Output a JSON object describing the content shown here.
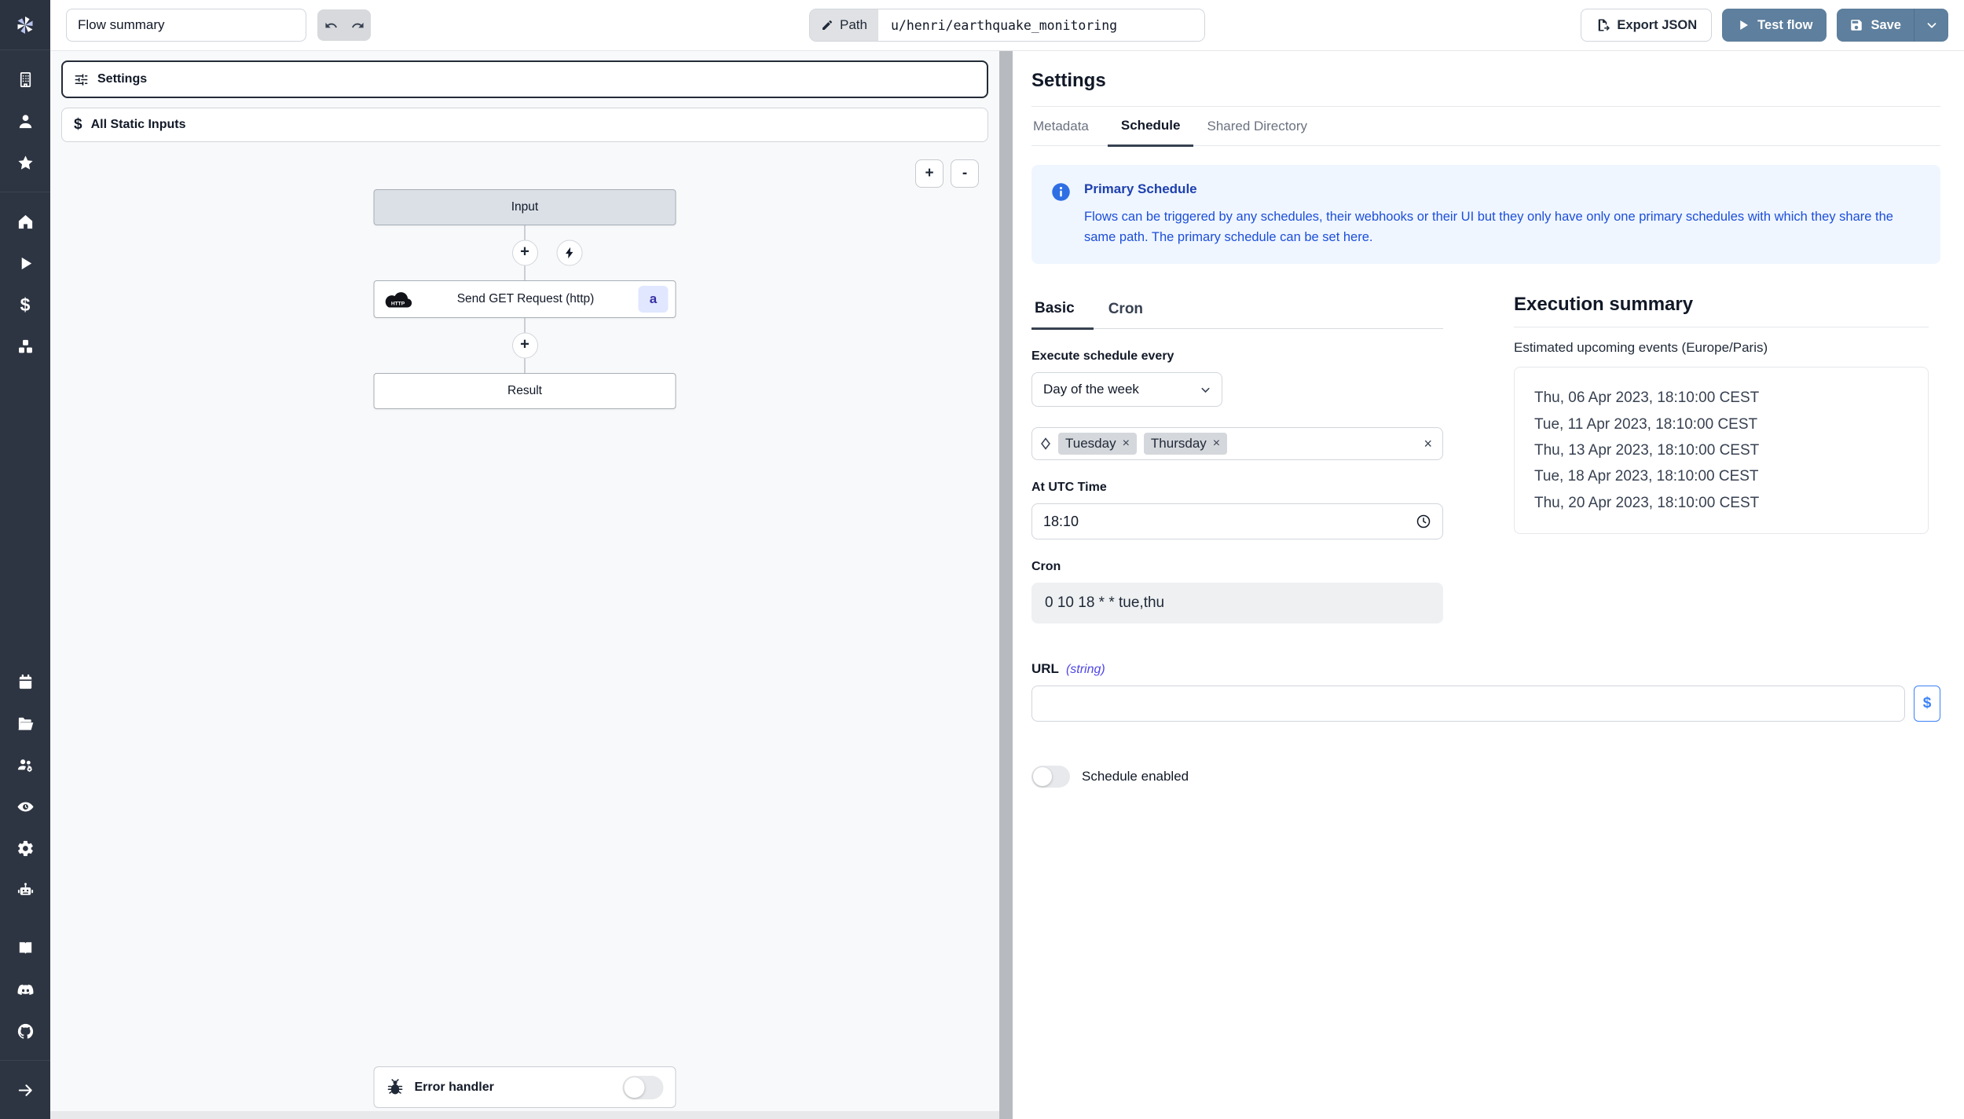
{
  "topbar": {
    "flow_summary": "Flow summary",
    "path": {
      "label": "Path",
      "value": "u/henri/earthquake_monitoring"
    },
    "buttons": {
      "export_json": "Export JSON",
      "test_flow": "Test flow",
      "save": "Save"
    }
  },
  "flow_panel": {
    "settings_button": "Settings",
    "static_inputs_button": "All Static Inputs",
    "static_inputs_icon": "$",
    "zoom_in": "+",
    "zoom_out": "-",
    "graph": {
      "input_node": "Input",
      "step_node": {
        "label": "Send GET Request (http)",
        "badge": "a",
        "icon_text": "HTTP"
      },
      "result_node": "Result"
    },
    "error_handler": {
      "label": "Error handler"
    }
  },
  "settings": {
    "title": "Settings",
    "tabs": [
      {
        "label": "Metadata"
      },
      {
        "label": "Schedule"
      },
      {
        "label": "Shared Directory"
      }
    ],
    "info_box": {
      "title": "Primary Schedule",
      "body": "Flows can be triggered by any schedules, their webhooks or their UI but they only have only one primary schedules with which they share the same path. The primary schedule can be set here."
    },
    "schedule": {
      "tabs": [
        {
          "label": "Basic"
        },
        {
          "label": "Cron"
        }
      ],
      "execute_label": "Execute schedule every",
      "frequency": "Day of the week",
      "selected_days": [
        {
          "label": "Tuesday"
        },
        {
          "label": "Thursday"
        }
      ],
      "utc_time_label": "At UTC Time",
      "utc_time": "18:10",
      "cron_label": "Cron",
      "cron_value": "0 10 18 * * tue,thu"
    },
    "execution_summary": {
      "title": "Execution summary",
      "subtitle": "Estimated upcoming events (Europe/Paris)",
      "events": [
        "Thu, 06 Apr 2023, 18:10:00 CEST",
        "Tue, 11 Apr 2023, 18:10:00 CEST",
        "Thu, 13 Apr 2023, 18:10:00 CEST",
        "Tue, 18 Apr 2023, 18:10:00 CEST",
        "Thu, 20 Apr 2023, 18:10:00 CEST"
      ]
    },
    "url_field": {
      "label": "URL",
      "type_hint": "(string)",
      "value": "",
      "dollar_button": "$"
    },
    "schedule_enabled_label": "Schedule enabled"
  },
  "colors": {
    "accent_button_blue": "#5e7f9d",
    "sidebar_bg": "#2e3542",
    "info_box_bg": "#eff6ff",
    "info_title_blue": "#1e40af",
    "info_body_blue": "#1d4ed8",
    "badge_bg": "#e0e7ff",
    "badge_text": "#3730a3",
    "dollar_button_blue": "#3b82f6"
  }
}
